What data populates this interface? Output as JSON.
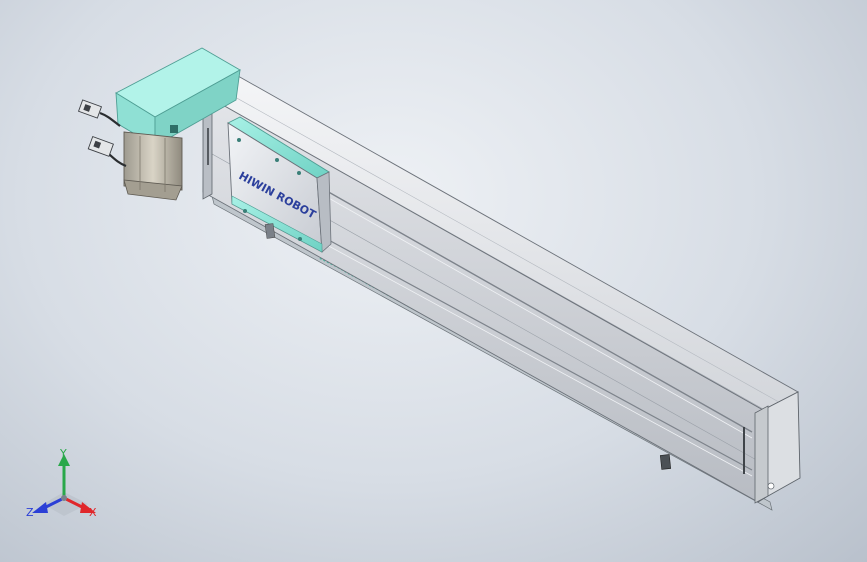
{
  "model": {
    "brand_label": "HIWIN ROBOT",
    "colors": {
      "body": "#d6d9de",
      "body_shade": "#a9aeb6",
      "carriage": "#8fe0d4",
      "motor": "#c8c2b3",
      "rack": "#5ec9b2"
    }
  },
  "triad": {
    "y_label": "Y",
    "x_label": "X",
    "z_label": "Z",
    "colors": {
      "x": "#e0272b",
      "y": "#29a84a",
      "z": "#2b3fd6"
    }
  }
}
